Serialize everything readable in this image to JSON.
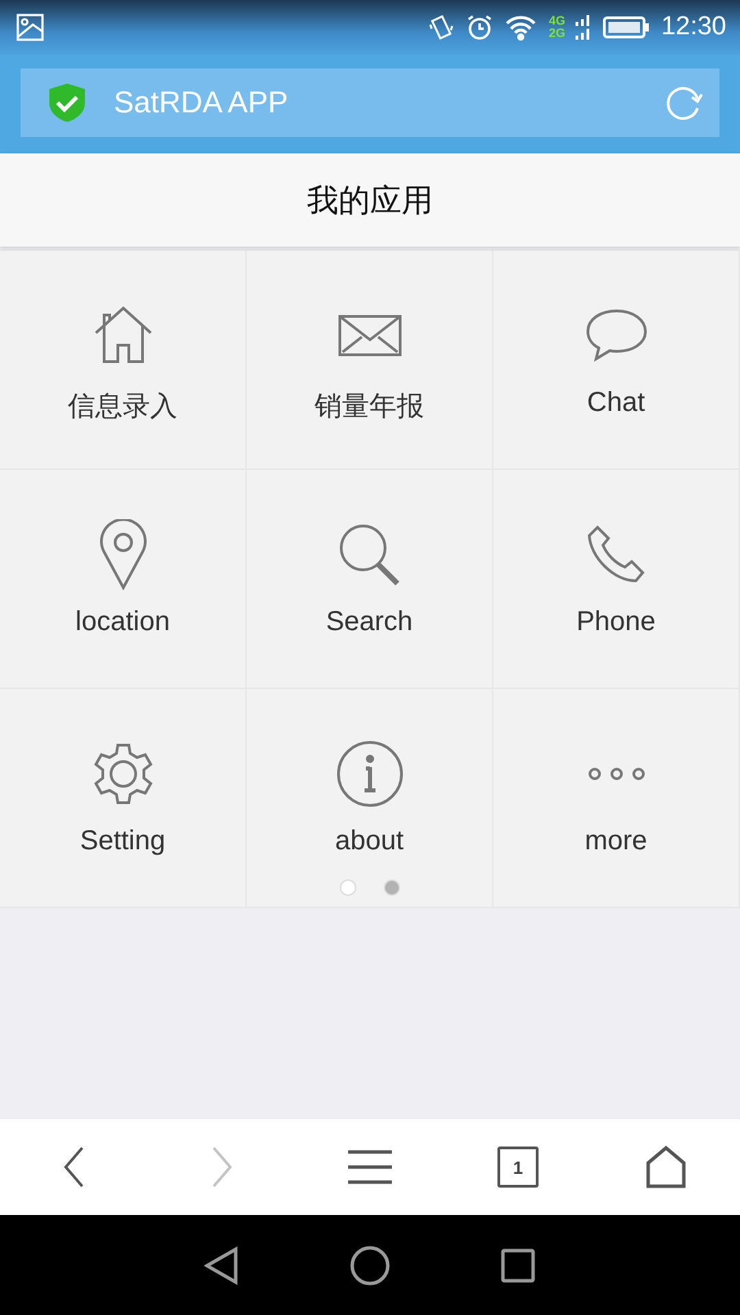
{
  "status_bar": {
    "network_top": "4G",
    "network_bottom": "2G",
    "time": "12:30"
  },
  "address_bar": {
    "title": "SatRDA APP"
  },
  "page_title": "我的应用",
  "apps": [
    {
      "label": "信息录入"
    },
    {
      "label": "销量年报"
    },
    {
      "label": "Chat"
    },
    {
      "label": "location"
    },
    {
      "label": "Search"
    },
    {
      "label": "Phone"
    },
    {
      "label": "Setting"
    },
    {
      "label": "about"
    },
    {
      "label": "more"
    }
  ],
  "pager": [
    {
      "selected": false
    },
    {
      "selected": true
    }
  ],
  "toolbar": {
    "back_disabled": false,
    "forward_disabled": true,
    "tab_count": "1"
  }
}
